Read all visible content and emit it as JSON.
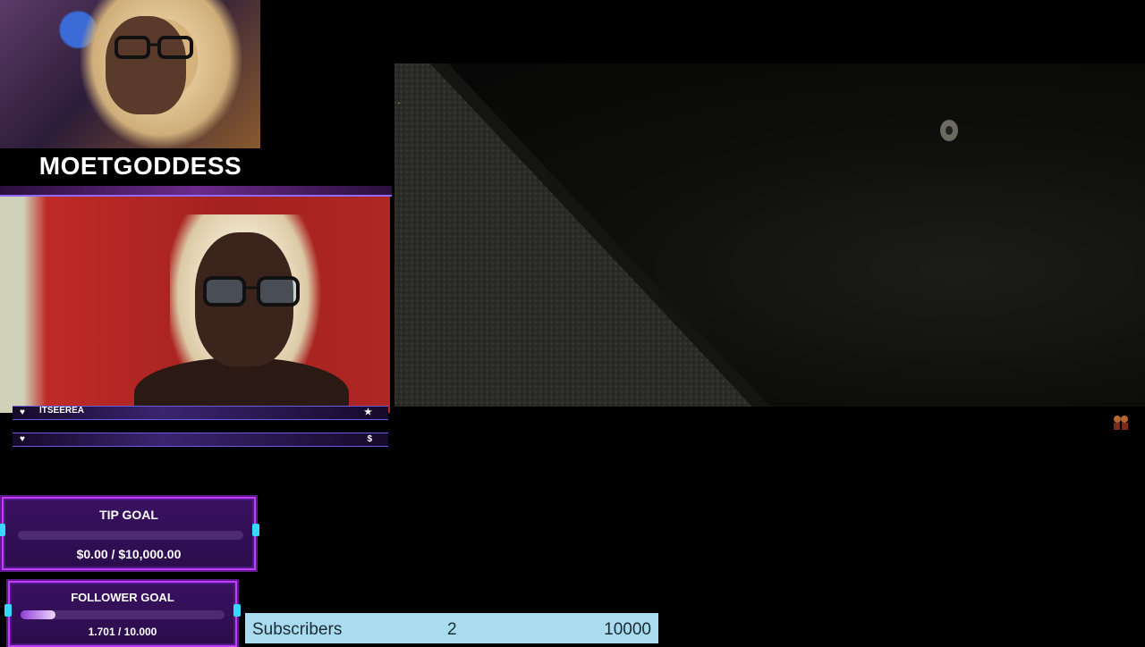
{
  "streamer": {
    "name": "MOETGODDESS"
  },
  "webcam_labels": {
    "bar1_name": "ITSEEREA",
    "bar1_icon": "heart-icon",
    "bar2_icon": "heart-icon"
  },
  "tip_goal": {
    "title": "TIP GOAL",
    "value": "$0.00 / $10,000.00",
    "progress": 0
  },
  "follower_goal": {
    "title": "FOLLOWER GOAL",
    "value": "1.701 / 10.000",
    "progress": 0.17
  },
  "subscribers_bar": {
    "label": "Subscribers",
    "current": "2",
    "target": "10000"
  },
  "colors": {
    "goal_border": "#c23bff",
    "goal_bg": "#3a1160",
    "subs_bg": "#a9dcef",
    "accent_cyan": "#36d8ff"
  }
}
